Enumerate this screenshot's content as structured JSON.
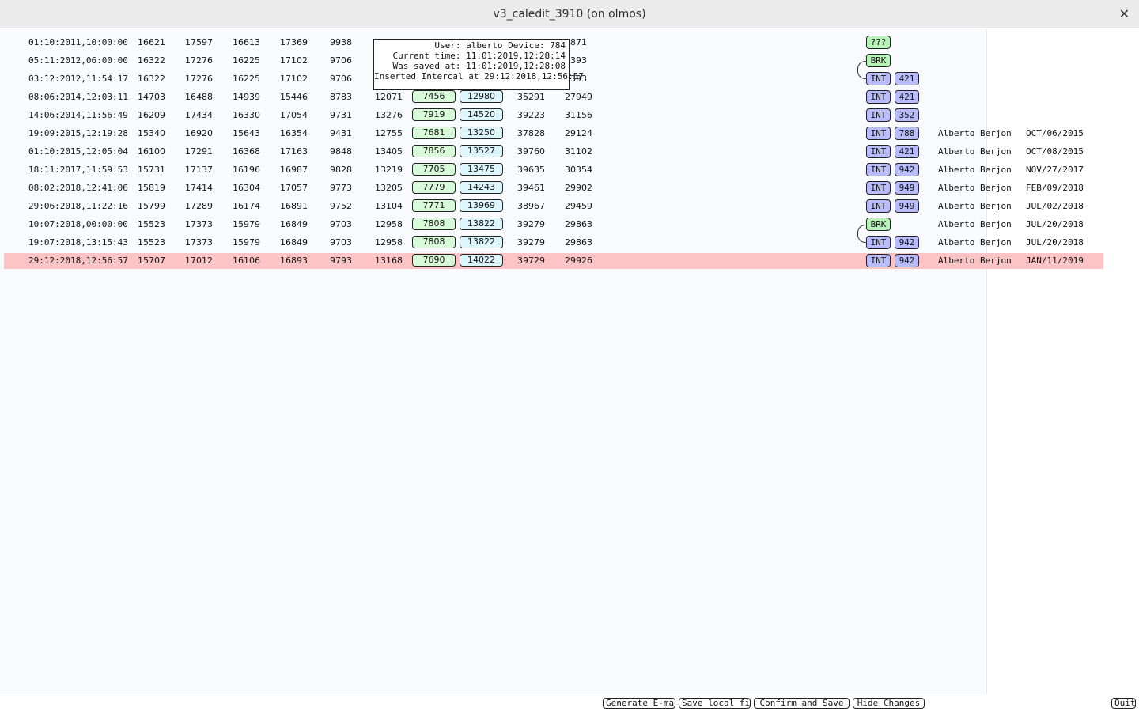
{
  "window": {
    "title": "v3_caledit_3910 (on olmos)",
    "close_glyph": "✕"
  },
  "rows": [
    {
      "date": "01:10:2011,10:00:00",
      "c1": "16621",
      "c2": "17597",
      "c3": "16613",
      "c4": "17369",
      "c5": "9938",
      "c6": "",
      "g": "",
      "b": "",
      "c7": "",
      "c8": "9871",
      "tag": "???",
      "tag_type": "q",
      "num": "",
      "user": "",
      "saved": ""
    },
    {
      "date": "05:11:2012,06:00:00",
      "c1": "16322",
      "c2": "17276",
      "c3": "16225",
      "c4": "17102",
      "c5": "9706",
      "c6": "",
      "g": "",
      "b": "",
      "c7": "",
      "c8": "1393",
      "tag": "BRK",
      "tag_type": "brk",
      "num": "",
      "user": "",
      "saved": ""
    },
    {
      "date": "03:12:2012,11:54:17",
      "c1": "16322",
      "c2": "17276",
      "c3": "16225",
      "c4": "17102",
      "c5": "9706",
      "c6": "",
      "g": "",
      "b": "",
      "c7": "",
      "c8": "1393",
      "tag": "INT",
      "tag_type": "int",
      "num": "421",
      "user": "",
      "saved": ""
    },
    {
      "date": "08:06:2014,12:03:11",
      "c1": "14703",
      "c2": "16488",
      "c3": "14939",
      "c4": "15446",
      "c5": "8783",
      "c6": "12071",
      "g": "7456",
      "b": "12980",
      "c7": "35291",
      "c8": "27949",
      "tag": "INT",
      "tag_type": "int",
      "num": "421",
      "user": "",
      "saved": ""
    },
    {
      "date": "14:06:2014,11:56:49",
      "c1": "16209",
      "c2": "17434",
      "c3": "16330",
      "c4": "17054",
      "c5": "9731",
      "c6": "13276",
      "g": "7919",
      "b": "14520",
      "c7": "39223",
      "c8": "31156",
      "tag": "INT",
      "tag_type": "int",
      "num": "352",
      "user": "",
      "saved": ""
    },
    {
      "date": "19:09:2015,12:19:28",
      "c1": "15340",
      "c2": "16920",
      "c3": "15643",
      "c4": "16354",
      "c5": "9431",
      "c6": "12755",
      "g": "7681",
      "b": "13250",
      "c7": "37828",
      "c8": "29124",
      "tag": "INT",
      "tag_type": "int",
      "num": "788",
      "user": "Alberto Berjon",
      "saved": "OCT/06/2015"
    },
    {
      "date": "01:10:2015,12:05:04",
      "c1": "16100",
      "c2": "17291",
      "c3": "16368",
      "c4": "17163",
      "c5": "9848",
      "c6": "13405",
      "g": "7856",
      "b": "13527",
      "c7": "39760",
      "c8": "31102",
      "tag": "INT",
      "tag_type": "int",
      "num": "421",
      "user": "Alberto Berjon",
      "saved": "OCT/08/2015"
    },
    {
      "date": "18:11:2017,11:59:53",
      "c1": "15731",
      "c2": "17137",
      "c3": "16196",
      "c4": "16987",
      "c5": "9828",
      "c6": "13219",
      "g": "7705",
      "b": "13475",
      "c7": "39635",
      "c8": "30354",
      "tag": "INT",
      "tag_type": "int",
      "num": "942",
      "user": "Alberto Berjon",
      "saved": "NOV/27/2017"
    },
    {
      "date": "08:02:2018,12:41:06",
      "c1": "15819",
      "c2": "17414",
      "c3": "16304",
      "c4": "17057",
      "c5": "9773",
      "c6": "13205",
      "g": "7779",
      "b": "14243",
      "c7": "39461",
      "c8": "29902",
      "tag": "INT",
      "tag_type": "int",
      "num": "949",
      "user": "Alberto Berjon",
      "saved": "FEB/09/2018"
    },
    {
      "date": "29:06:2018,11:22:16",
      "c1": "15799",
      "c2": "17289",
      "c3": "16174",
      "c4": "16891",
      "c5": "9752",
      "c6": "13104",
      "g": "7771",
      "b": "13969",
      "c7": "38967",
      "c8": "29459",
      "tag": "INT",
      "tag_type": "int",
      "num": "949",
      "user": "Alberto Berjon",
      "saved": "JUL/02/2018"
    },
    {
      "date": "10:07:2018,00:00:00",
      "c1": "15523",
      "c2": "17373",
      "c3": "15979",
      "c4": "16849",
      "c5": "9703",
      "c6": "12958",
      "g": "7808",
      "b": "13822",
      "c7": "39279",
      "c8": "29863",
      "tag": "BRK",
      "tag_type": "brk",
      "num": "",
      "user": "Alberto Berjon",
      "saved": "JUL/20/2018"
    },
    {
      "date": "19:07:2018,13:15:43",
      "c1": "15523",
      "c2": "17373",
      "c3": "15979",
      "c4": "16849",
      "c5": "9703",
      "c6": "12958",
      "g": "7808",
      "b": "13822",
      "c7": "39279",
      "c8": "29863",
      "tag": "INT",
      "tag_type": "int",
      "num": "942",
      "user": "Alberto Berjon",
      "saved": "JUL/20/2018"
    },
    {
      "date": "29:12:2018,12:56:57",
      "c1": "15707",
      "c2": "17012",
      "c3": "16106",
      "c4": "16893",
      "c5": "9793",
      "c6": "13168",
      "g": "7690",
      "b": "14022",
      "c7": "39729",
      "c8": "29926",
      "tag": "INT",
      "tag_type": "int",
      "num": "942",
      "user": "Alberto Berjon",
      "saved": "JAN/11/2019",
      "highlight": true
    }
  ],
  "tooltip": {
    "lines": [
      "User: alberto Device: 784",
      "Current time: 11:01:2019,12:28:14",
      "Was saved at: 11:01:2019,12:28:08",
      "Inserted Intercal at 29:12:2018,12:56:57"
    ]
  },
  "buttons": {
    "email": "Generate E-mail",
    "save_local": "Save local file",
    "confirm": "Confirm and Save",
    "hide": "Hide Changes",
    "quit": "Quit"
  },
  "colors": {
    "highlight": "#fdc4c6",
    "int_tag": "#b8bcfa",
    "brk_tag": "#b9f2b9"
  }
}
